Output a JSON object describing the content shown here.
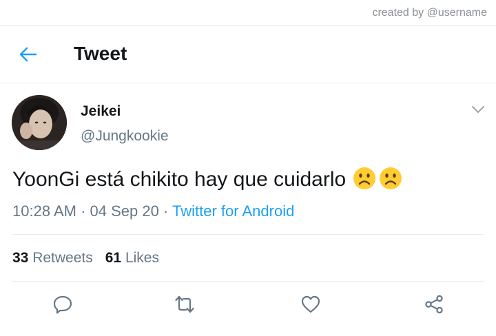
{
  "credit": "created by @username",
  "header": {
    "title": "Tweet",
    "back_icon": "back-arrow-icon"
  },
  "tweet": {
    "author_name": "Jeikei",
    "author_handle": "@Jungkookie",
    "text": "YoonGi está chikito hay que cuidarlo",
    "emojis": [
      "frowning-face",
      "frowning-face"
    ],
    "time": "10:28 AM",
    "date": "04 Sep 20",
    "separator": "·",
    "source": "Twitter for Android"
  },
  "stats": {
    "retweets_count": "33",
    "retweets_label": "Retweets",
    "likes_count": "61",
    "likes_label": "Likes"
  },
  "actions": [
    "reply-icon",
    "retweet-icon",
    "like-icon",
    "share-icon"
  ],
  "colors": {
    "accent": "#1da1f2",
    "secondary_text": "#657786",
    "primary_text": "#14171a",
    "divider": "#e6ecf0",
    "emoji_fill": "#ffcc33"
  }
}
